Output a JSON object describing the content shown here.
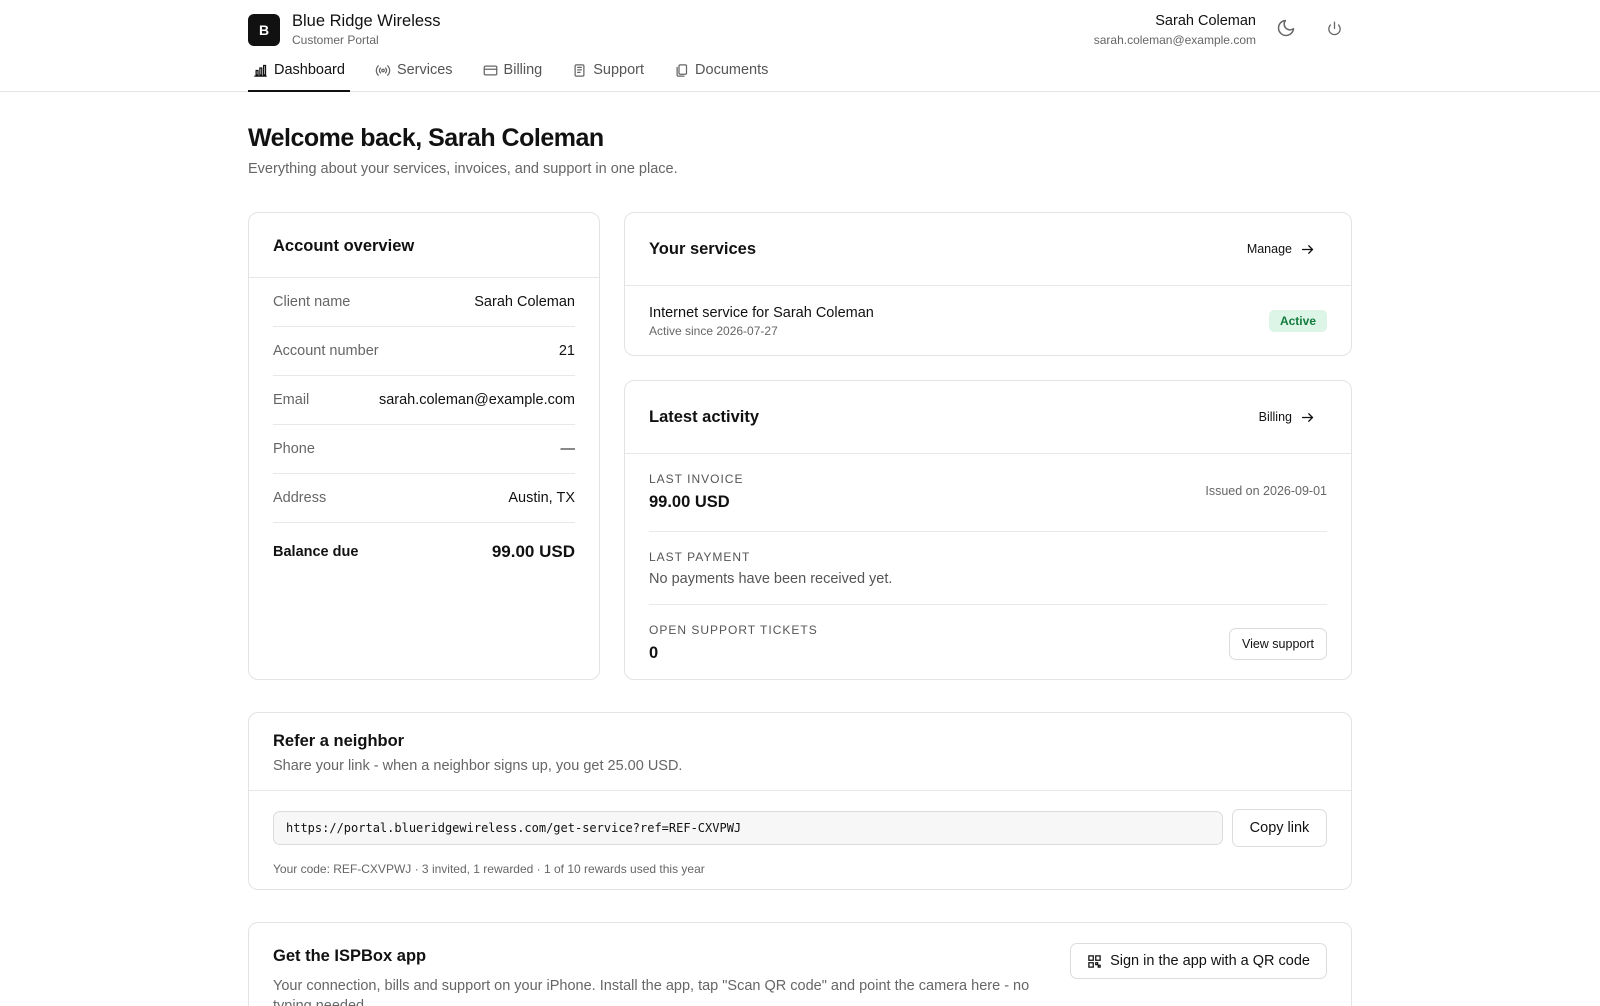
{
  "brand": {
    "logo_letter": "B",
    "name": "Blue Ridge Wireless",
    "subtitle": "Customer Portal"
  },
  "user": {
    "name": "Sarah Coleman",
    "email": "sarah.coleman@example.com"
  },
  "nav": {
    "tabs": [
      {
        "label": "Dashboard",
        "icon": "chart-icon",
        "active": true
      },
      {
        "label": "Services",
        "icon": "broadcast-icon",
        "active": false
      },
      {
        "label": "Billing",
        "icon": "credit-card-icon",
        "active": false
      },
      {
        "label": "Support",
        "icon": "support-icon",
        "active": false
      },
      {
        "label": "Documents",
        "icon": "documents-icon",
        "active": false
      }
    ]
  },
  "welcome": {
    "title": "Welcome back, Sarah Coleman",
    "subtitle": "Everything about your services, invoices, and support in one place."
  },
  "account": {
    "title": "Account overview",
    "rows": [
      {
        "label": "Client name",
        "value": "Sarah Coleman"
      },
      {
        "label": "Account number",
        "value": "21"
      },
      {
        "label": "Email",
        "value": "sarah.coleman@example.com"
      },
      {
        "label": "Phone",
        "value": "—"
      },
      {
        "label": "Address",
        "value": "Austin, TX"
      }
    ],
    "balance_label": "Balance due",
    "balance_value": "99.00 USD"
  },
  "services": {
    "title": "Your services",
    "manage_label": "Manage",
    "items": [
      {
        "name": "Internet service for Sarah Coleman",
        "since": "Active since 2026-07-27",
        "status": "Active"
      }
    ]
  },
  "activity": {
    "title": "Latest activity",
    "billing_label": "Billing",
    "last_invoice_label": "LAST INVOICE",
    "last_invoice_value": "99.00 USD",
    "issued": "Issued on 2026-09-01",
    "last_payment_label": "LAST PAYMENT",
    "last_payment_text": "No payments have been received yet.",
    "tickets_label": "OPEN SUPPORT TICKETS",
    "tickets_value": "0",
    "view_support_label": "View support"
  },
  "refer": {
    "title": "Refer a neighbor",
    "subtitle": "Share your link - when a neighbor signs up, you get 25.00 USD.",
    "link": "https://portal.blueridgewireless.com/get-service?ref=REF-CXVPWJ",
    "copy_label": "Copy link",
    "meta": "Your code: REF-CXVPWJ · 3 invited, 1 rewarded · 1 of 10 rewards used this year"
  },
  "app": {
    "title": "Get the ISPBox app",
    "description": "Your connection, bills and support on your iPhone. Install the app, tap \"Scan QR code\" and point the camera here - no typing needed.",
    "qr_button_label": "Sign in the app with a QR code"
  },
  "colors": {
    "accent": "#111111",
    "badge_bg": "#dcf5e6",
    "badge_text": "#147a3d",
    "border": "#e3e3e3"
  }
}
